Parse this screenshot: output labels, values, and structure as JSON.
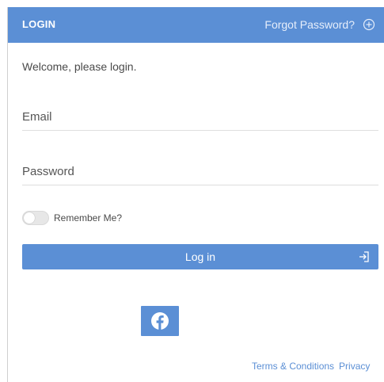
{
  "header": {
    "title": "LOGIN",
    "forgot_label": "Forgot Password?",
    "forgot_icon": "plus-circle-icon"
  },
  "main": {
    "welcome_text": "Welcome, please login."
  },
  "form": {
    "email_placeholder": "Email",
    "email_value": "",
    "password_placeholder": "Password",
    "password_value": "",
    "remember_label": "Remember Me?",
    "remember_checked": false,
    "login_label": "Log in",
    "login_icon": "sign-in-icon"
  },
  "social": {
    "facebook_icon": "facebook-icon"
  },
  "footer": {
    "terms_label": "Terms & Conditions",
    "privacy_label": "Privacy"
  },
  "colors": {
    "accent": "#5b8fd5",
    "header_text": "#ffffff",
    "body_text": "#4a4a4a",
    "link": "#5b8fd5"
  }
}
